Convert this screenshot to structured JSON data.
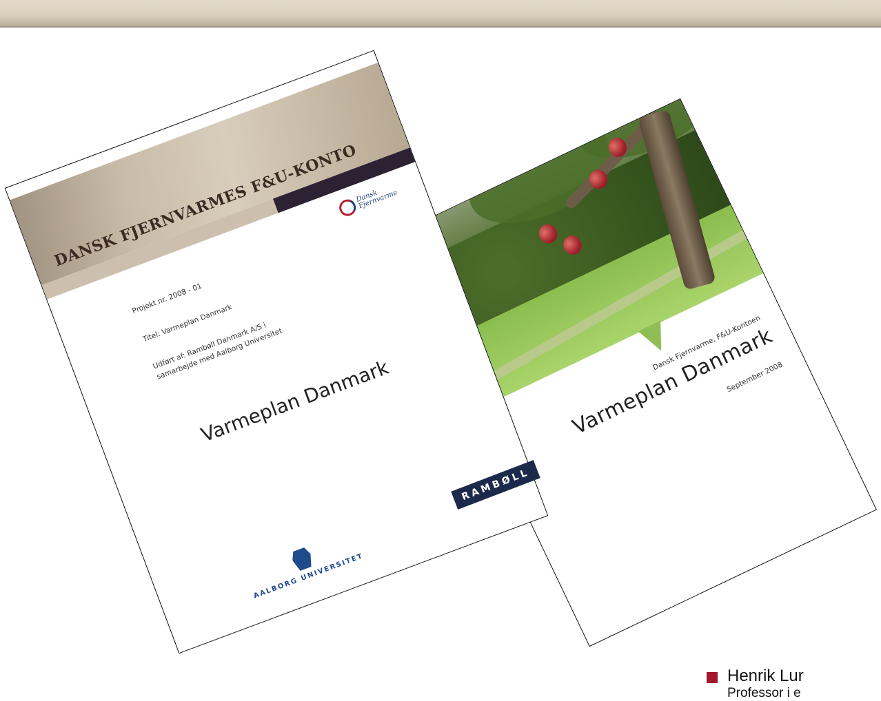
{
  "header": {
    "band_color": "#d8cfbb"
  },
  "report_front": {
    "banner_title": "DANSK FJERNVARMES F&U-KONTO",
    "partner_logo": "Dansk\nFjernvarme",
    "project_nr": "Projekt nr. 2008 - 01",
    "titel": "Titel: Varmeplan Danmark",
    "udfort_line1": "Udført af: Rambøll Danmark A/S i",
    "udfort_line2": "samarbejde med Aalborg Universitet",
    "title": "Varmeplan Danmark",
    "university_logo": "AALBORG UNIVERSITET"
  },
  "report_back": {
    "publisher": "Dansk Fjernvarme, F&U-Kontoen",
    "title": "Varmeplan Danmark",
    "date": "September 2008",
    "company_logo": "RAMBØLL"
  },
  "bullet": {
    "name": "Henrik Lur",
    "role": "Professor i e",
    "color": "#a3162b"
  }
}
